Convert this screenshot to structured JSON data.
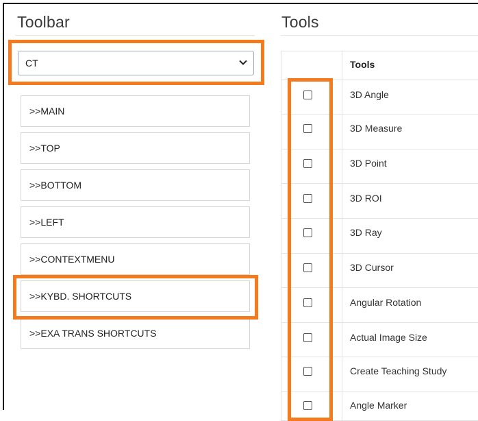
{
  "toolbar": {
    "title": "Toolbar",
    "selected_modality": "CT",
    "items": [
      {
        "label": ">>MAIN"
      },
      {
        "label": ">>TOP"
      },
      {
        "label": ">>BOTTOM"
      },
      {
        "label": ">>LEFT"
      },
      {
        "label": ">>CONTEXTMENU"
      },
      {
        "label": ">>KYBD. SHORTCUTS"
      },
      {
        "label": ">>EXA TRANS SHORTCUTS"
      }
    ]
  },
  "tools": {
    "title": "Tools",
    "column_header": "Tools",
    "rows": [
      {
        "label": "3D Angle",
        "checked": false
      },
      {
        "label": "3D Measure",
        "checked": false
      },
      {
        "label": "3D Point",
        "checked": false
      },
      {
        "label": "3D ROI",
        "checked": false
      },
      {
        "label": "3D Ray",
        "checked": false
      },
      {
        "label": "3D Cursor",
        "checked": false
      },
      {
        "label": "Angular Rotation",
        "checked": false
      },
      {
        "label": "Actual Image Size",
        "checked": false
      },
      {
        "label": "Create Teaching Study",
        "checked": false
      },
      {
        "label": "Angle Marker",
        "checked": false
      }
    ]
  },
  "colors": {
    "highlight": "#f47a20",
    "border": "#d6d6d6"
  }
}
